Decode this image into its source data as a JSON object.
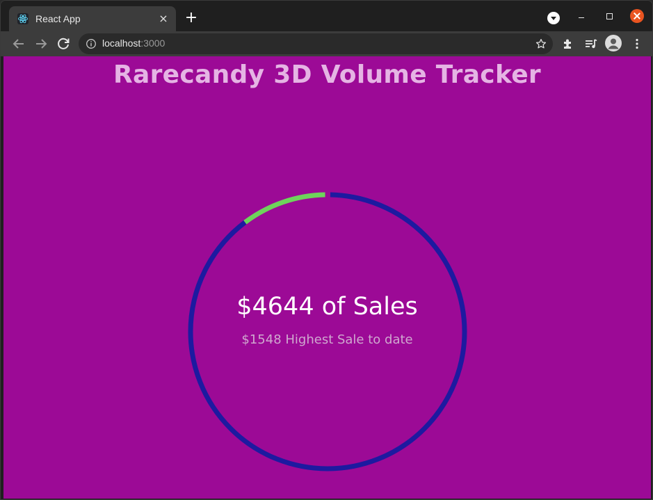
{
  "browser": {
    "tab": {
      "title": "React App",
      "favicon": "react-logo-icon",
      "close_icon": "×"
    },
    "new_tab_icon": "+",
    "url": {
      "host": "localhost",
      "port": ":3000"
    }
  },
  "page": {
    "title": "Rarecandy 3D Volume Tracker",
    "gauge": {
      "sales_label": "$4644 of Sales",
      "highest_label": "$1548 Highest Sale to date",
      "progress_fraction": 0.1,
      "progress_color": "#6ed45b",
      "track_color": "#1d1aa0",
      "background_color": "#9c0a96"
    }
  }
}
